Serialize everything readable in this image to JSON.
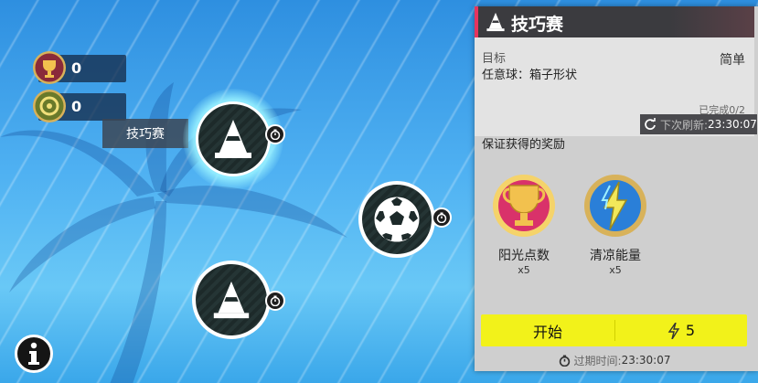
{
  "currencies": [
    {
      "icon": "trophy-coin-icon",
      "value": "0"
    },
    {
      "icon": "target-coin-icon",
      "value": "0"
    }
  ],
  "map": {
    "selected_node_label": "技巧赛",
    "nodes": [
      {
        "icon": "cone-icon",
        "timer_icon": "stopwatch-icon"
      },
      {
        "icon": "soccer-ball-icon",
        "timer_icon": "stopwatch-icon"
      },
      {
        "icon": "cone-icon",
        "timer_icon": "stopwatch-icon"
      }
    ]
  },
  "panel": {
    "title": "技巧赛",
    "goal_label": "目标",
    "difficulty": "简单",
    "goal_text": "任意球：箱子形状",
    "completed": "已完成0/2",
    "refresh_label": "下次刷新:",
    "refresh_time": "23:30:07",
    "reward_title": "保证获得的奖励",
    "rewards": [
      {
        "icon": "sunshine-points-icon",
        "name": "阳光点数",
        "qty": "x5"
      },
      {
        "icon": "cool-energy-icon",
        "name": "清凉能量",
        "qty": "x5"
      }
    ],
    "start_label": "开始",
    "cost": "5",
    "expire_label": "过期时间:",
    "expire_time": "23:30:07"
  },
  "colors": {
    "accent": "#e6345d",
    "start_button": "#f2f21a",
    "header": "#3b3b3f"
  }
}
